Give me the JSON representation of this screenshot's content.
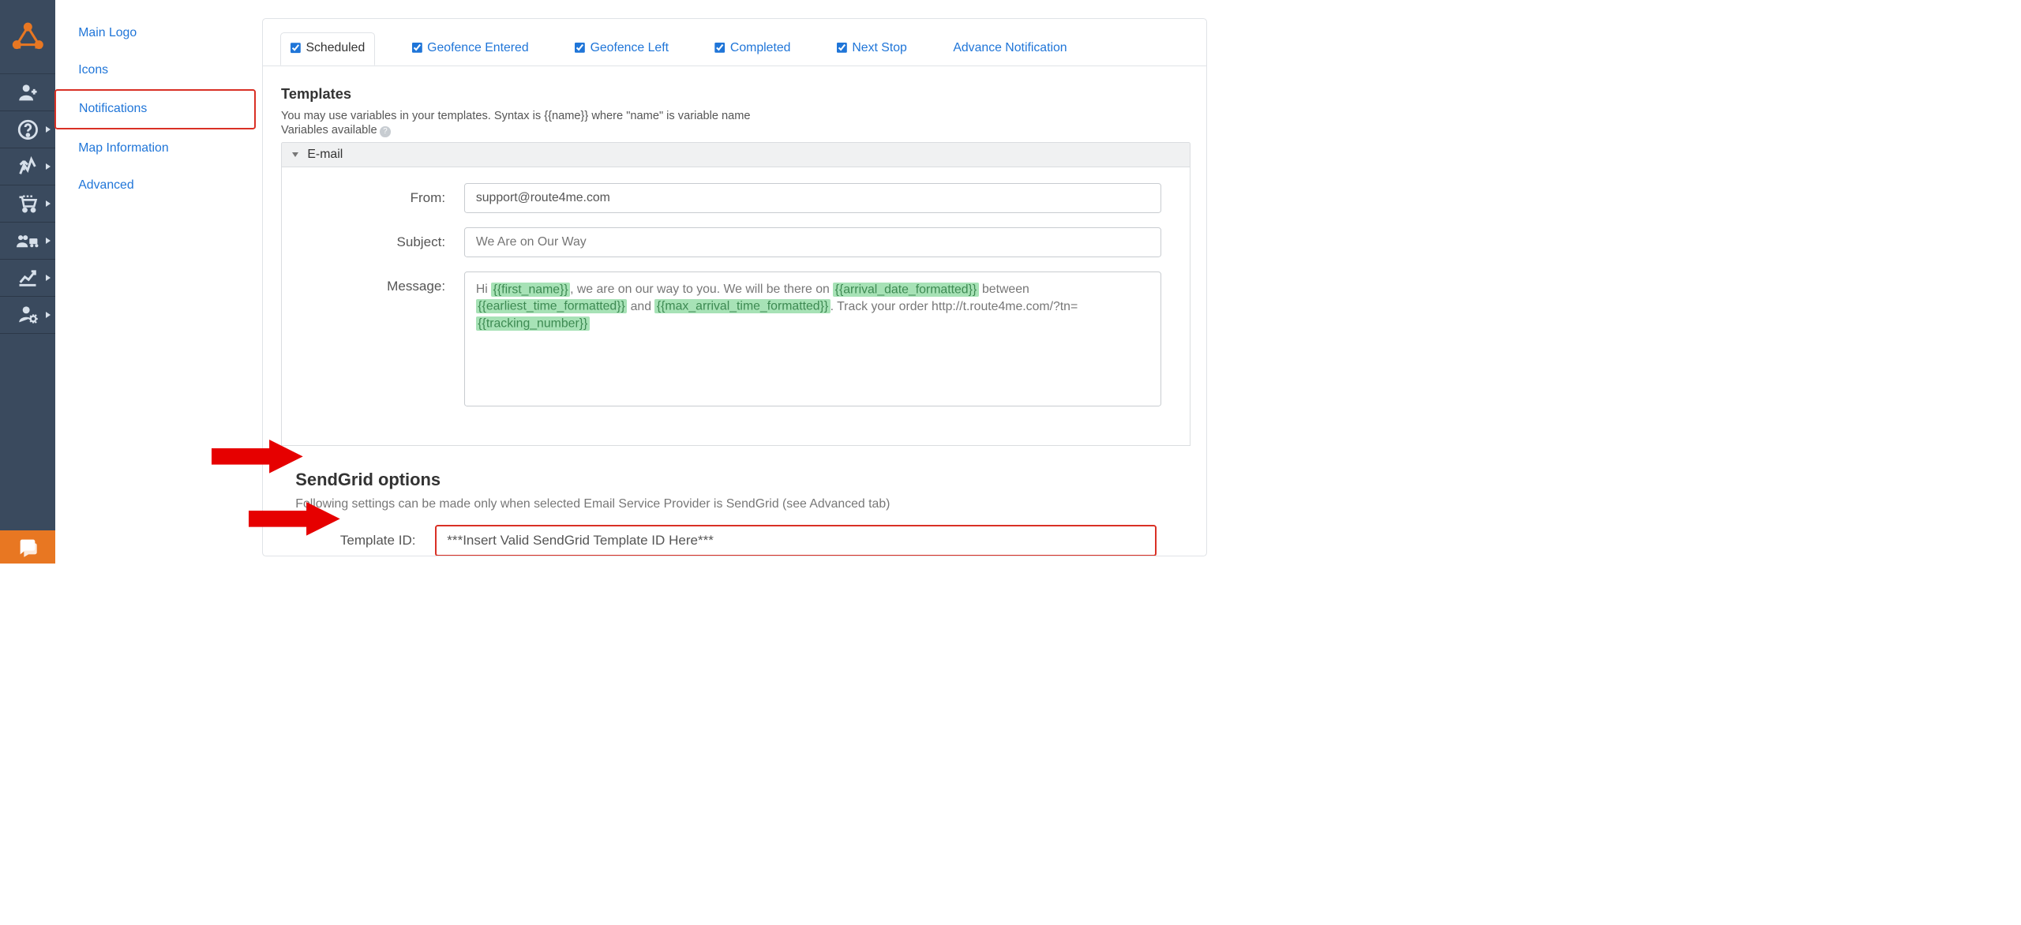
{
  "secondary_nav": {
    "items": [
      {
        "label": "Main Logo"
      },
      {
        "label": "Icons"
      },
      {
        "label": "Notifications"
      },
      {
        "label": "Map Information"
      },
      {
        "label": "Advanced"
      }
    ]
  },
  "tabs": [
    {
      "label": "Scheduled",
      "checked": true,
      "active": true
    },
    {
      "label": "Geofence Entered",
      "checked": true
    },
    {
      "label": "Geofence Left",
      "checked": true
    },
    {
      "label": "Completed",
      "checked": true
    },
    {
      "label": "Next Stop",
      "checked": true
    },
    {
      "label": "Advance Notification",
      "checked": false,
      "link_only": true
    }
  ],
  "templates": {
    "heading": "Templates",
    "help1": "You may use variables in your templates. Syntax is {{name}} where \"name\" is variable name",
    "help2": "Variables available",
    "section_label": "E-mail",
    "from_label": "From:",
    "from_value": "support@route4me.com",
    "subject_label": "Subject:",
    "subject_placeholder": "We Are on Our Way",
    "message_label": "Message:",
    "msg_part1": "Hi ",
    "msg_var1": "{{first_name}}",
    "msg_part2": ", we are on our way to you. We will be there on ",
    "msg_var2": "{{arrival_date_formatted}}",
    "msg_part3": " between ",
    "msg_var3": "{{earliest_time_formatted}}",
    "msg_part4": " and ",
    "msg_var4": "{{max_arrival_time_formatted}}",
    "msg_part5": ". Track your order http://t.route4me.com/?tn=",
    "msg_var5": "{{tracking_number}}"
  },
  "sendgrid": {
    "title": "SendGrid options",
    "sub": "Following settings can be made only when selected Email Service Provider is SendGrid (see Advanced tab)",
    "template_id_label": "Template ID:",
    "template_id_value": "***Insert Valid SendGrid Template ID Here***"
  }
}
